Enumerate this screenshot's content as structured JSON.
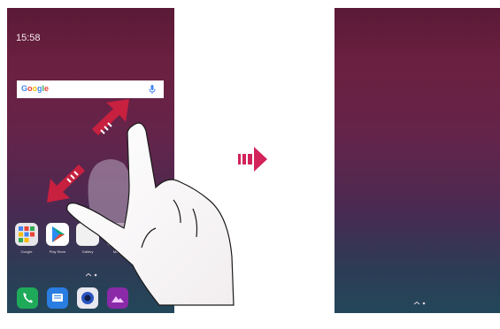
{
  "home_screen": {
    "clock_time": "15:58",
    "search_bar": {
      "logo_text": "Google"
    },
    "apps": [
      {
        "label": "Google"
      },
      {
        "label": "Play Store"
      },
      {
        "label": "Gallery"
      },
      {
        "label": "Music"
      }
    ],
    "dock": [
      "phone",
      "messages",
      "camera",
      "gallery"
    ]
  },
  "transition_arrow": {
    "color": "#d2235a"
  },
  "gesture": {
    "type": "pinch-in"
  }
}
